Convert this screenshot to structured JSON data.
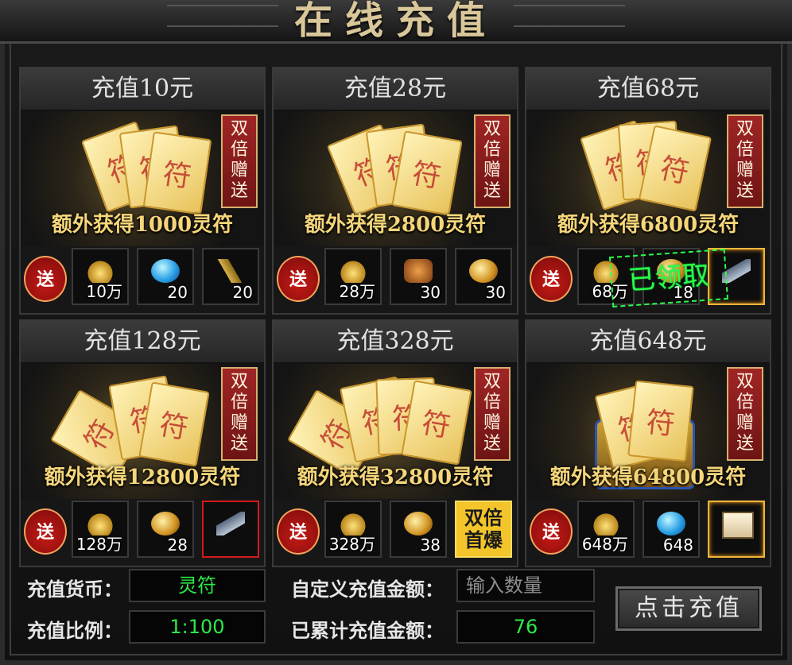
{
  "header": {
    "title": "在线充值"
  },
  "cards": [
    {
      "label": "充值10元",
      "badge": "双倍赠送",
      "bonus": "额外获得1000灵符",
      "rewards": [
        {
          "icon": "gold-ingot-icon",
          "qty": "10万"
        },
        {
          "icon": "blue-gem-icon",
          "qty": "20"
        },
        {
          "icon": "golden-stick-icon",
          "qty": "20"
        }
      ]
    },
    {
      "label": "充值28元",
      "badge": "双倍赠送",
      "bonus": "额外获得2800灵符",
      "rewards": [
        {
          "icon": "gold-ingot-icon",
          "qty": "28万"
        },
        {
          "icon": "rune-bag-icon",
          "qty": "30"
        },
        {
          "icon": "fire-orb-icon",
          "qty": "30"
        }
      ]
    },
    {
      "label": "充值68元",
      "badge": "双倍赠送",
      "bonus": "额外获得6800灵符",
      "rewards": [
        {
          "icon": "gold-ingot-icon",
          "qty": "68万"
        },
        {
          "icon": "golden-orb-icon",
          "qty": "18"
        },
        {
          "icon": "scroll-icon",
          "qty": ""
        }
      ],
      "claimed_stamp": "已领取"
    },
    {
      "label": "充值128元",
      "badge": "双倍赠送",
      "bonus": "额外获得12800灵符",
      "rewards": [
        {
          "icon": "gold-ingot-icon",
          "qty": "128万"
        },
        {
          "icon": "golden-orb-icon",
          "qty": "28"
        },
        {
          "icon": "scroll-icon",
          "qty": ""
        }
      ]
    },
    {
      "label": "充值328元",
      "badge": "双倍赠送",
      "bonus": "额外获得32800灵符",
      "rewards": [
        {
          "icon": "gold-ingot-icon",
          "qty": "328万"
        },
        {
          "icon": "golden-orb-icon",
          "qty": "38"
        },
        {
          "icon": "double-first-drop-badge",
          "qty": "双倍首爆"
        }
      ]
    },
    {
      "label": "充值648元",
      "badge": "双倍赠送",
      "bonus": "额外获得64800灵符",
      "rewards": [
        {
          "icon": "gold-ingot-icon",
          "qty": "648万"
        },
        {
          "icon": "blue-gem-icon",
          "qty": "648"
        },
        {
          "icon": "book-icon",
          "qty": ""
        }
      ]
    }
  ],
  "send_label": "送",
  "form": {
    "currency_label": "充值货币：",
    "currency_value": "灵符",
    "ratio_label": "充值比例：",
    "ratio_value": "1:100",
    "custom_label": "自定义充值金额：",
    "custom_placeholder": "输入数量",
    "total_label": "已累计充值金额：",
    "total_value": "76",
    "submit_label": "点击充值"
  },
  "colors": {
    "accent_gold": "#f5d67a",
    "value_green": "#2ee84a",
    "badge_red": "#a02525"
  }
}
